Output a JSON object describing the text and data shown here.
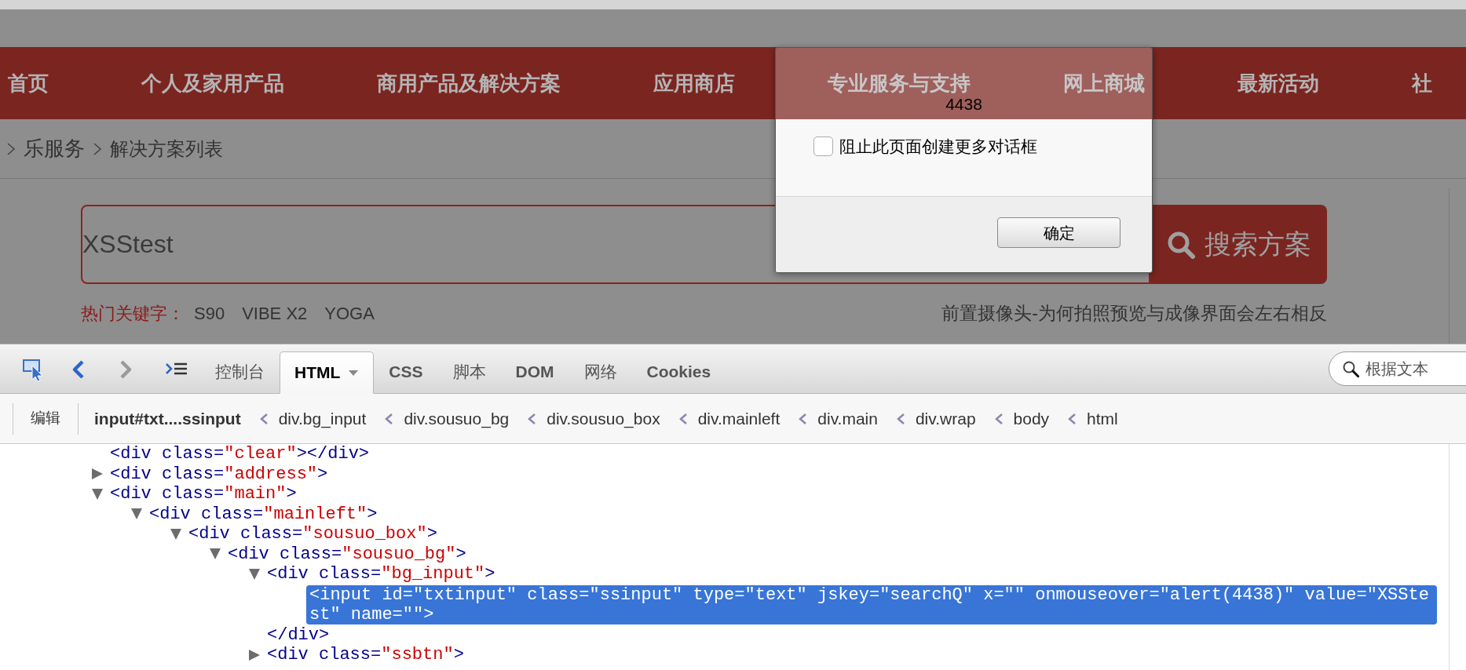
{
  "nav_menu": {
    "items": [
      {
        "label": "首页"
      },
      {
        "label": "个人及家用产品"
      },
      {
        "label": "商用产品及解决方案"
      },
      {
        "label": "应用商店"
      },
      {
        "label": "专业服务与支持"
      },
      {
        "label": "网上商城"
      },
      {
        "label": "最新活动"
      },
      {
        "label": "社"
      }
    ]
  },
  "breadcrumb": {
    "items": [
      {
        "label": "乐服务"
      },
      {
        "label": "解决方案列表"
      }
    ]
  },
  "search": {
    "value": "XSStest",
    "button": "搜索方案"
  },
  "hot_keywords": {
    "label": "热门关键字：",
    "items": [
      "S90",
      "VIBE X2",
      "YOGA"
    ]
  },
  "featured_question": "前置摄像头-为何拍照预览与成像界面会左右相反",
  "alert_dialog": {
    "message": "4438",
    "checkbox": {
      "label": "阻止此页面创建更多对话框",
      "checked": false
    },
    "button": "确定"
  },
  "devtools": {
    "tabs": [
      {
        "label": "控制台",
        "selected": false,
        "dropdown": false
      },
      {
        "label": "HTML",
        "selected": true,
        "dropdown": true
      },
      {
        "label": "CSS",
        "selected": false,
        "dropdown": false
      },
      {
        "label": "脚本",
        "selected": false,
        "dropdown": false
      },
      {
        "label": "DOM",
        "selected": false,
        "dropdown": false
      },
      {
        "label": "网络",
        "selected": false,
        "dropdown": false
      },
      {
        "label": "Cookies",
        "selected": false,
        "dropdown": false
      }
    ],
    "search_placeholder": "根据文本",
    "edit_button": "编辑",
    "element_path": [
      {
        "label": "input#txt....ssinput",
        "selected": true
      },
      {
        "label": "div.bg_input",
        "selected": false
      },
      {
        "label": "div.sousuo_bg",
        "selected": false
      },
      {
        "label": "div.sousuo_box",
        "selected": false
      },
      {
        "label": "div.mainleft",
        "selected": false
      },
      {
        "label": "div.main",
        "selected": false
      },
      {
        "label": "div.wrap",
        "selected": false
      },
      {
        "label": "body",
        "selected": false
      },
      {
        "label": "html",
        "selected": false
      }
    ],
    "dom_tree": [
      {
        "code": "<div class=\"clear\"></div>",
        "selected": false
      },
      {
        "code": "<div class=\"address\">",
        "expanded": false,
        "selected": false
      },
      {
        "code": "<div class=\"main\">",
        "expanded": true,
        "selected": false,
        "children": [
          {
            "code": "<div class=\"mainleft\">",
            "expanded": true,
            "selected": false,
            "children": [
              {
                "code": "<div class=\"sousuo_box\">",
                "expanded": true,
                "selected": false,
                "children": [
                  {
                    "code": "<div class=\"sousuo_bg\">",
                    "expanded": true,
                    "selected": false,
                    "children": [
                      {
                        "code": "<div class=\"bg_input\">",
                        "expanded": true,
                        "selected": false,
                        "end_tag": "</div>",
                        "children": [
                          {
                            "code": "<input id=\"txtinput\" class=\"ssinput\" type=\"text\" jskey=\"searchQ\" x=\"\" onmouseover=\"alert(4438)\" value=\"XSStest\" name=\"\">",
                            "selected": true
                          }
                        ]
                      },
                      {
                        "code": "<div class=\"ssbtn\">",
                        "expanded": false,
                        "selected": false
                      }
                    ]
                  }
                ]
              }
            ]
          }
        ]
      }
    ]
  }
}
